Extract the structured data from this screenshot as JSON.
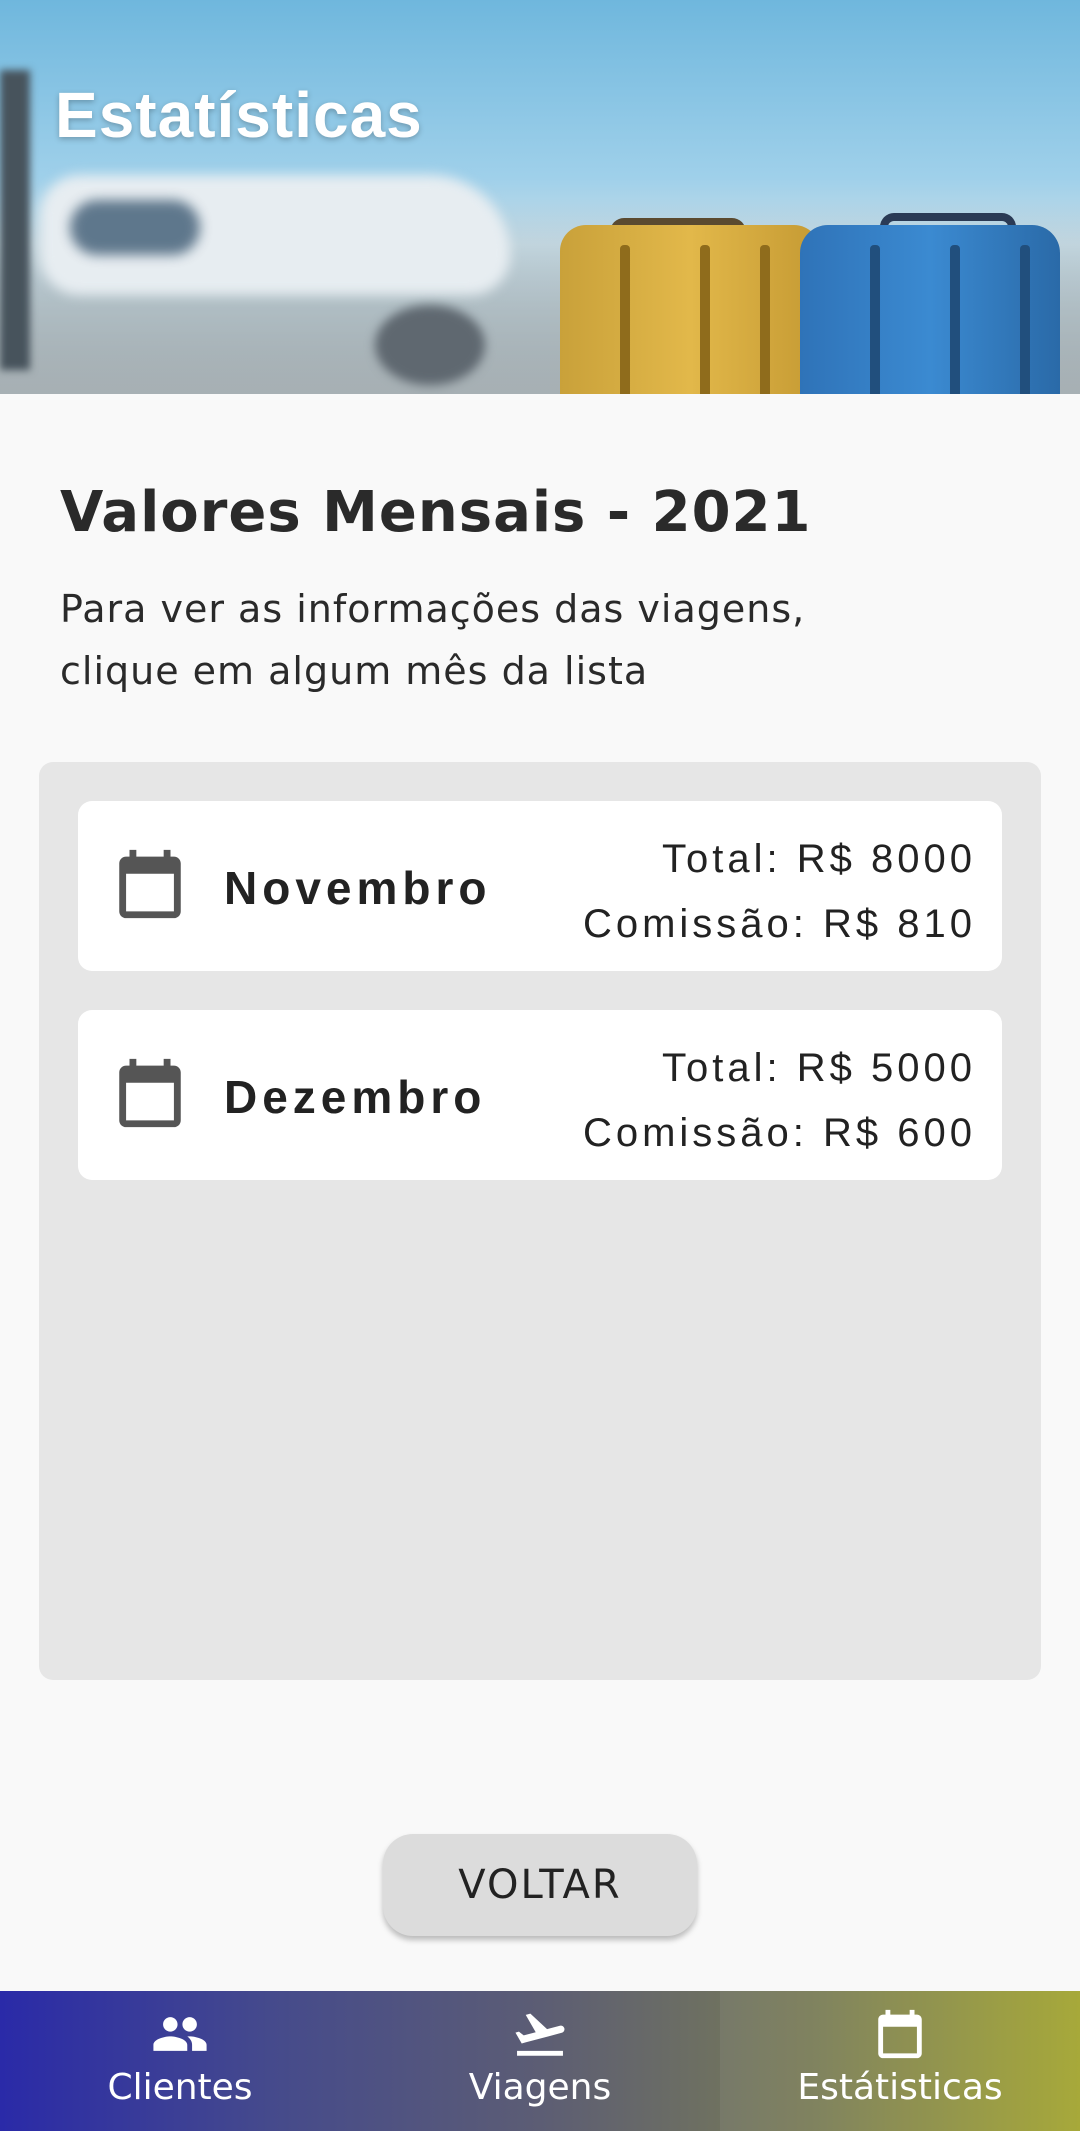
{
  "header": {
    "title": "Estatísticas"
  },
  "section": {
    "title": "Valores Mensais - 2021",
    "subtitle_line1": "Para ver as informações das viagens,",
    "subtitle_line2": "clique em algum mês da lista"
  },
  "months": [
    {
      "name": "Novembro",
      "total": "Total: R$ 8000",
      "commission": "Comissão: R$ 810",
      "icon": "calendar-icon"
    },
    {
      "name": "Dezembro",
      "total": "Total: R$ 5000",
      "commission": "Comissão: R$ 600",
      "icon": "calendar-icon"
    }
  ],
  "actions": {
    "back_label": "VOLTAR"
  },
  "nav": {
    "items": [
      {
        "label": "Clientes",
        "icon": "people-icon",
        "active": false
      },
      {
        "label": "Viagens",
        "icon": "airplane-icon",
        "active": false
      },
      {
        "label": "Estátisticas",
        "icon": "calendar-icon",
        "active": true
      }
    ]
  },
  "colors": {
    "nav_gradient_start": "#2a2aa8",
    "nav_gradient_end": "#a2a42e",
    "panel_bg": "#e6e6e6",
    "button_bg": "#dcdcdc"
  }
}
